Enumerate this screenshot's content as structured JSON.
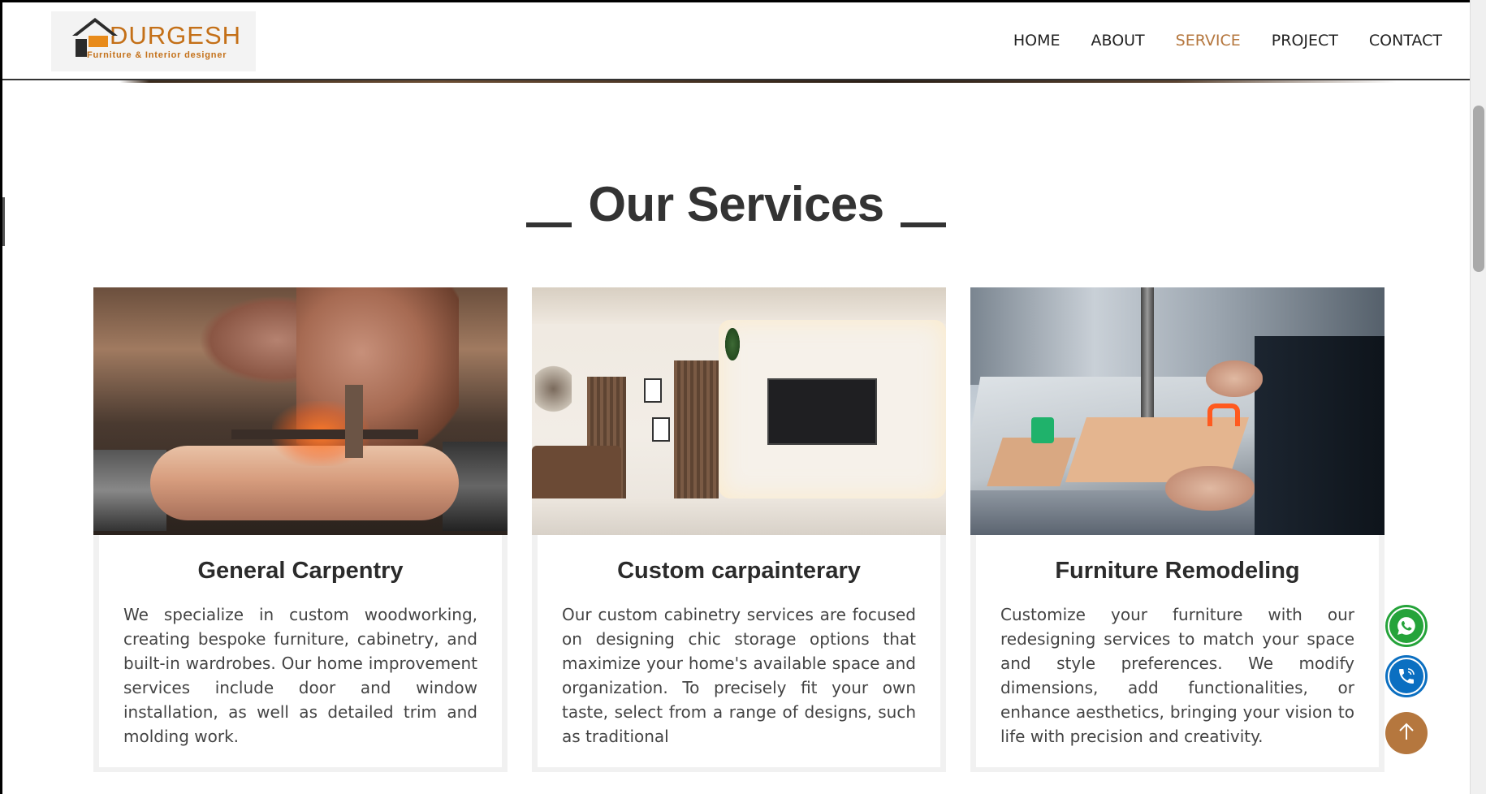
{
  "brand": {
    "name": "DURGESH",
    "tagline": "Furniture & Interior designer",
    "accent": "#b5773e",
    "logo_color": "#c47018"
  },
  "nav": {
    "items": [
      {
        "label": "HOME",
        "active": false
      },
      {
        "label": "ABOUT",
        "active": false
      },
      {
        "label": "SERVICE",
        "active": true
      },
      {
        "label": "PROJECT",
        "active": false
      },
      {
        "label": "CONTACT",
        "active": false
      }
    ]
  },
  "services": {
    "title": "Our Services",
    "cards": [
      {
        "image": "carpentry-lathe-photo",
        "title": "General Carpentry",
        "text": "We specialize in custom woodworking, creating bespoke furniture, cabinetry, and built-in wardrobes. Our home improvement services include door and window installation, as well as detailed trim and molding work."
      },
      {
        "image": "interior-living-room-photo",
        "title": "Custom carpainterary",
        "text": "Our custom cabinetry services are focused on designing chic storage options that maximize your home's available space and organization. To precisely fit your own taste, select from a range of designs, such as traditional"
      },
      {
        "image": "furniture-remodeling-photo",
        "title": "Furniture Remodeling",
        "text": "Customize your furniture with our redesigning services to match your space and style preferences. We modify dimensions, add functionalities, or enhance aesthetics, bringing your vision to life with precision and creativity."
      }
    ]
  },
  "floating": {
    "whatsapp_icon": "whatsapp-icon",
    "call_icon": "phone-icon",
    "top_icon": "arrow-up-icon",
    "whatsapp_color": "#25a33a",
    "call_color": "#0b6fc1"
  }
}
